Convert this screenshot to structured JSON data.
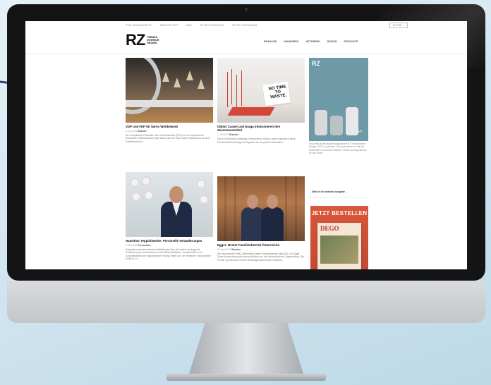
{
  "colors": {
    "background": "#cfe4ef",
    "arrow": "#24476a",
    "bezel": "#141414",
    "aluminium": "#c3c6c9",
    "brand_text": "#111111"
  },
  "topbar": {
    "links": [
      "STELLENANGEBOTE",
      "NEWSLETTER",
      "ABO",
      "RZ BEI FACEBOOK",
      "RZ BEI INSTAGRAM"
    ],
    "search_label": "SUCHE"
  },
  "logo": {
    "mark": "RZ",
    "line1": "TRENDS",
    "line2": "INTERIOR",
    "line3": "DESIGN"
  },
  "nav": [
    "BRANCHE",
    "HANDWERK",
    "NETZWERK",
    "DESIGN",
    "PRODUKTE"
  ],
  "articles": [
    {
      "title": "VDP und FEP für fairen Wettbewerb",
      "date": "8. Juli 2021",
      "category": "Branche",
      "text": "Die Europäische Föderation der Parkettindustrie (FEP) und der Verband der Deutschen Parkettindustrie (vdp) setzen sich für einen fairen Wettbewerb auf dem Parkettmarkt ein."
    },
    {
      "title": "Object Carpet und Nraga intensivieren ihre Zusammenarbeit",
      "date": "7. Juli 2021",
      "category": "Branche",
      "text": "Das in Denkendorf ansässige Unternehmen Object Carpet intensiviert seine Partnerschaft mit Nraga für Teppiche aus recycelten Materialien.",
      "sign": "NO TIME TO WASTE."
    },
    {
      "title": "Hamelner Teppichwerke: Personelle Veränderungen",
      "date": "6. Mai 2021",
      "category": "Personalien",
      "text": "Aufgrund unternehmerischer Aufstellungen über die weitere strategische Entwicklung des Unternehmens wird Martin Wolfbauer, Gesellschafter und Geschäftsführer der Teppichwerke Holding GmbH und der Hamelner Teppichwerke GmbH & Co."
    },
    {
      "title": "Egger: Bester Familienbetrieb Österreichs",
      "date": "30. April 2021",
      "category": "Branche",
      "text": "Der renommierte Preis „Österreichs bester Familienbetrieb“ ging 2021 an Egger. Diese Auszeichnung wird einmal jährlich von der österreichischen Tageszeitung „Die Presse“ gemeinsam mit dem Beratungsunternehmen vergeben."
    }
  ],
  "sidebar": {
    "ad1": {
      "logo": "RZ",
      "label": "SV"
    },
    "text": "Im Schnitt ist die aktuelle Ausgabe der RZ Trends Interior Design 4/2021 erschienen. Wir präsentieren im Titel die Wohnwelten und neue Produkte, Trends und Inspirationen für den Raum.",
    "link": "→ Blick in die aktuelle Ausgabe →",
    "ad2": {
      "header": "JETZT BESTELLEN",
      "mag_title": "DEGO"
    }
  }
}
